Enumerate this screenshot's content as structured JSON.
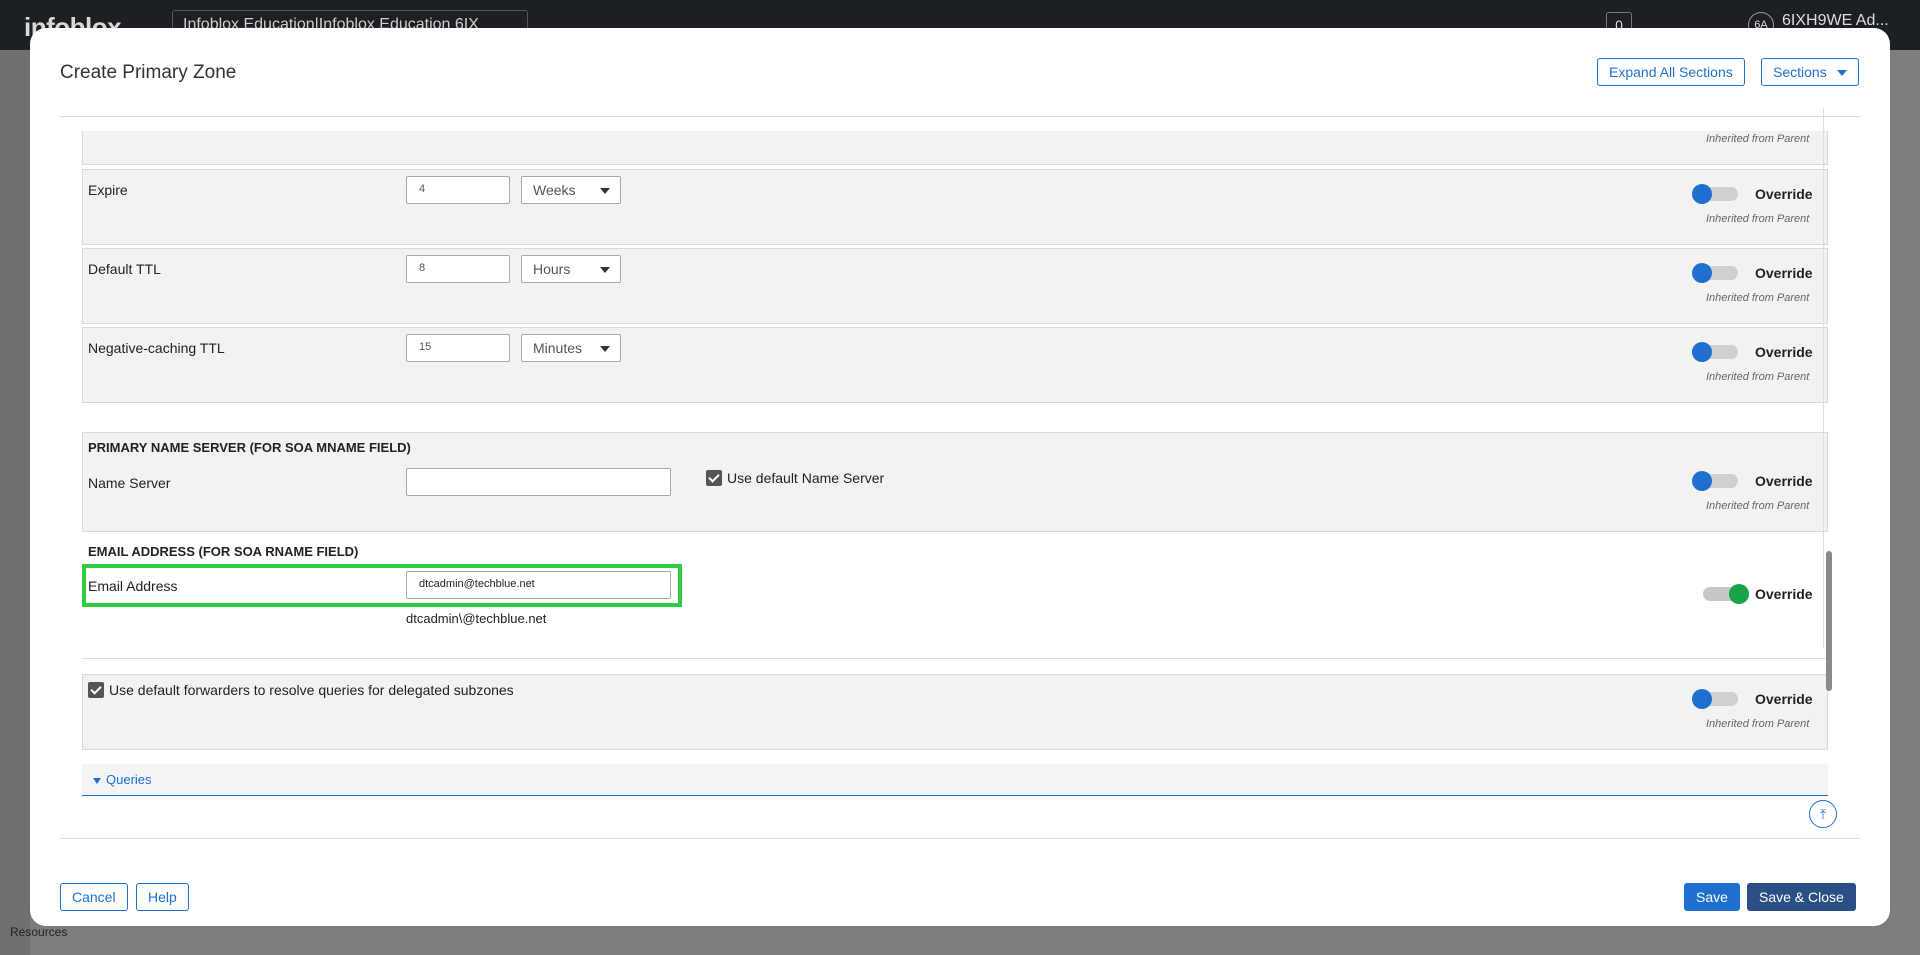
{
  "app": {
    "logo": "infoblox",
    "breadcrumb": "Infoblox Education|Infoblox Education 6IX",
    "notifications": "0",
    "user_initials": "6A",
    "user_name": "6IXH9WE Ad...",
    "sidebar_bottom_label": "Resources"
  },
  "modal": {
    "title": "Create Primary Zone",
    "expand_all_label": "Expand All Sections",
    "sections_label": "Sections"
  },
  "common": {
    "override_label": "Override",
    "inherited_label": "Inherited from Parent"
  },
  "soa": {
    "expire": {
      "label": "Expire",
      "value": "4",
      "unit": "Weeks"
    },
    "default_ttl": {
      "label": "Default TTL",
      "value": "8",
      "unit": "Hours"
    },
    "negative_ttl": {
      "label": "Negative-caching TTL",
      "value": "15",
      "unit": "Minutes"
    }
  },
  "primary_ns": {
    "heading": "PRIMARY NAME SERVER (FOR SOA MNAME FIELD)",
    "label": "Name Server",
    "value": "",
    "use_default_label": "Use default Name Server",
    "use_default_checked": true
  },
  "email": {
    "heading": "EMAIL ADDRESS (FOR SOA RNAME FIELD)",
    "label": "Email Address",
    "value": "dtcadmin@techblue.net",
    "escaped_preview": "dtcadmin\\@techblue.net",
    "override_on": true
  },
  "forwarders": {
    "label": "Use default forwarders to resolve queries for delegated subzones",
    "checked": true
  },
  "queries": {
    "label": "Queries"
  },
  "footer": {
    "cancel_label": "Cancel",
    "help_label": "Help",
    "save_label": "Save",
    "save_close_label": "Save & Close"
  },
  "colors": {
    "accent": "#1f6fd1",
    "save_close": "#2a4f85",
    "toggle_on": "#16a34a",
    "highlight": "#2ecc40"
  }
}
